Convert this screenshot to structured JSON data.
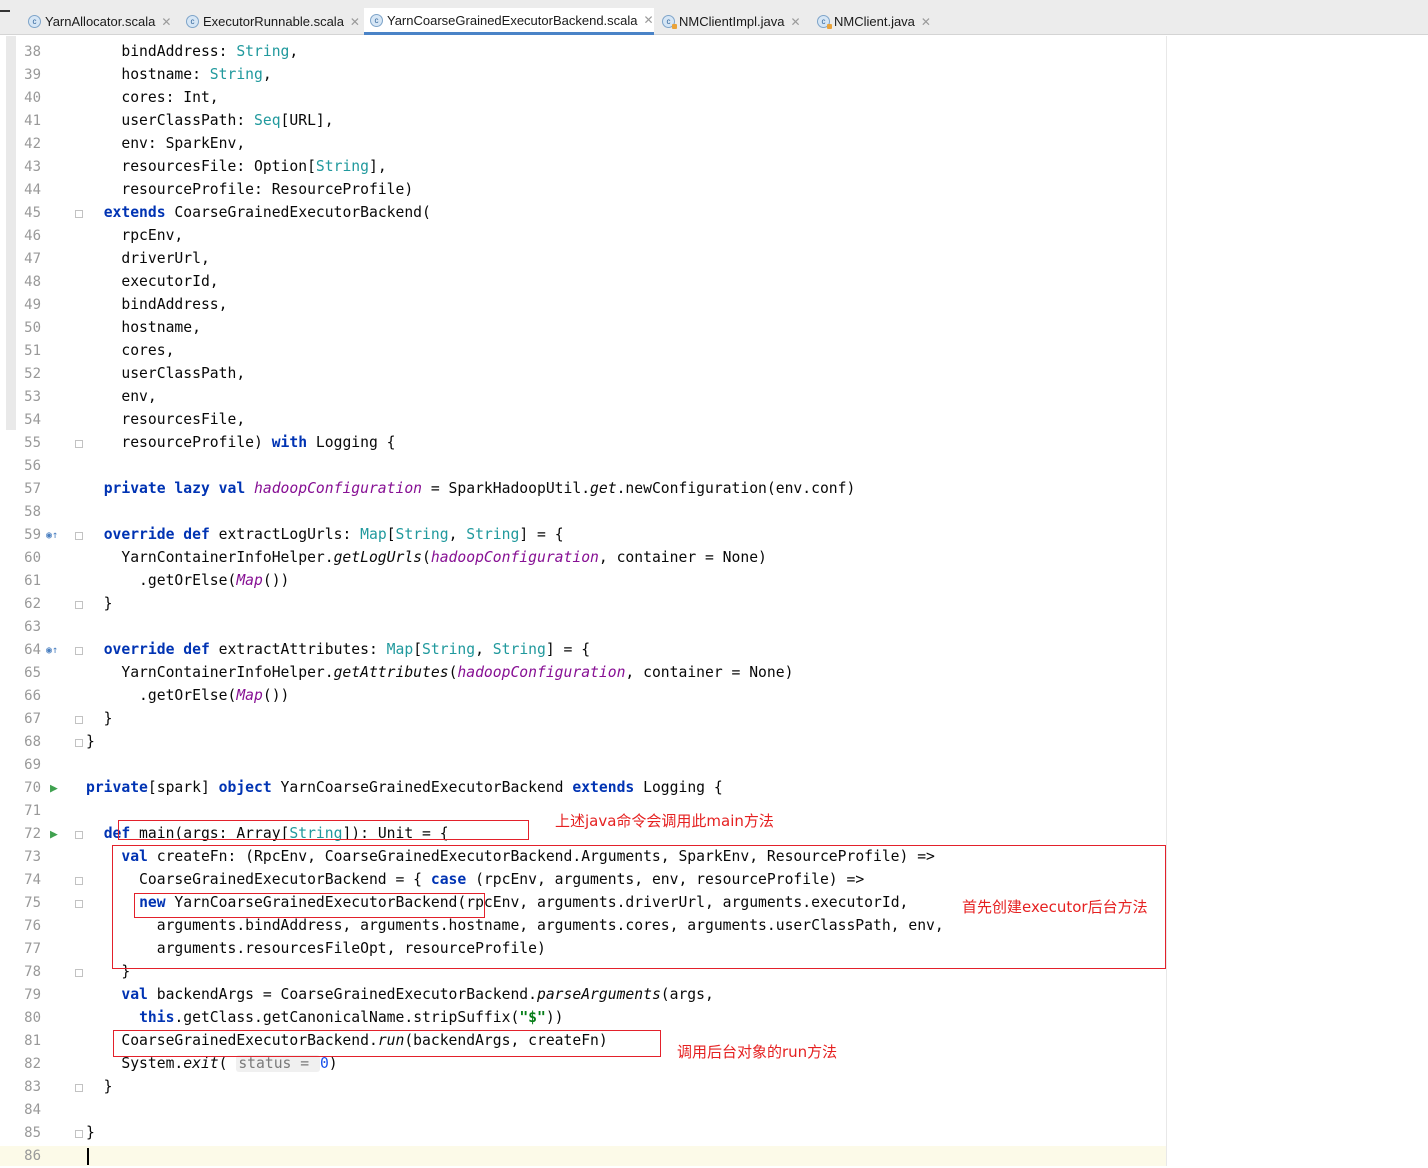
{
  "tabs": [
    {
      "label": "YarnAllocator.scala",
      "kind": "scala",
      "active": false
    },
    {
      "label": "ExecutorRunnable.scala",
      "kind": "scala",
      "active": false
    },
    {
      "label": "YarnCoarseGrainedExecutorBackend.scala",
      "kind": "scala",
      "active": true
    },
    {
      "label": "NMClientImpl.java",
      "kind": "java",
      "active": false
    },
    {
      "label": "NMClient.java",
      "kind": "java",
      "active": false
    }
  ],
  "line_numbers": [
    "38",
    "39",
    "40",
    "41",
    "42",
    "43",
    "44",
    "45",
    "46",
    "47",
    "48",
    "49",
    "50",
    "51",
    "52",
    "53",
    "54",
    "55",
    "56",
    "57",
    "58",
    "59",
    "60",
    "61",
    "62",
    "63",
    "64",
    "65",
    "66",
    "67",
    "68",
    "69",
    "70",
    "71",
    "72",
    "73",
    "74",
    "75",
    "76",
    "77",
    "78",
    "79",
    "80",
    "81",
    "82",
    "83",
    "84",
    "85",
    "86"
  ],
  "code_lines": [
    [
      {
        "t": "    bindAddress: "
      },
      {
        "t": "String",
        "c": "ty"
      },
      {
        "t": ","
      }
    ],
    [
      {
        "t": "    hostname: "
      },
      {
        "t": "String",
        "c": "ty"
      },
      {
        "t": ","
      }
    ],
    [
      {
        "t": "    cores: Int,"
      }
    ],
    [
      {
        "t": "    userClassPath: "
      },
      {
        "t": "Seq",
        "c": "ty"
      },
      {
        "t": "[URL],"
      }
    ],
    [
      {
        "t": "    env: SparkEnv,"
      }
    ],
    [
      {
        "t": "    resourcesFile: Option["
      },
      {
        "t": "String",
        "c": "ty"
      },
      {
        "t": "],"
      }
    ],
    [
      {
        "t": "    resourceProfile: ResourceProfile)"
      }
    ],
    [
      {
        "t": "  "
      },
      {
        "t": "extends",
        "c": "kw"
      },
      {
        "t": " CoarseGrainedExecutorBackend("
      }
    ],
    [
      {
        "t": "    rpcEnv,"
      }
    ],
    [
      {
        "t": "    driverUrl,"
      }
    ],
    [
      {
        "t": "    executorId,"
      }
    ],
    [
      {
        "t": "    bindAddress,"
      }
    ],
    [
      {
        "t": "    hostname,"
      }
    ],
    [
      {
        "t": "    cores,"
      }
    ],
    [
      {
        "t": "    userClassPath,"
      }
    ],
    [
      {
        "t": "    env,"
      }
    ],
    [
      {
        "t": "    resourcesFile,"
      }
    ],
    [
      {
        "t": "    resourceProfile) "
      },
      {
        "t": "with",
        "c": "kw"
      },
      {
        "t": " Logging {"
      }
    ],
    [],
    [
      {
        "t": "  "
      },
      {
        "t": "private lazy val",
        "c": "kw"
      },
      {
        "t": " "
      },
      {
        "t": "hadoopConfiguration",
        "c": "it"
      },
      {
        "t": " = SparkHadoopUtil."
      },
      {
        "t": "get",
        "c": "fn"
      },
      {
        "t": ".newConfiguration(env.conf)"
      }
    ],
    [],
    [
      {
        "t": "  "
      },
      {
        "t": "override def",
        "c": "kw"
      },
      {
        "t": " extractLogUrls: "
      },
      {
        "t": "Map",
        "c": "ty"
      },
      {
        "t": "["
      },
      {
        "t": "String",
        "c": "ty"
      },
      {
        "t": ", "
      },
      {
        "t": "String",
        "c": "ty"
      },
      {
        "t": "] = {"
      }
    ],
    [
      {
        "t": "    YarnContainerInfoHelper."
      },
      {
        "t": "getLogUrls",
        "c": "fn"
      },
      {
        "t": "("
      },
      {
        "t": "hadoopConfiguration",
        "c": "it"
      },
      {
        "t": ", container = None)"
      }
    ],
    [
      {
        "t": "      .getOrElse("
      },
      {
        "t": "Map",
        "c": "it"
      },
      {
        "t": "())"
      }
    ],
    [
      {
        "t": "  }"
      }
    ],
    [],
    [
      {
        "t": "  "
      },
      {
        "t": "override def",
        "c": "kw"
      },
      {
        "t": " extractAttributes: "
      },
      {
        "t": "Map",
        "c": "ty"
      },
      {
        "t": "["
      },
      {
        "t": "String",
        "c": "ty"
      },
      {
        "t": ", "
      },
      {
        "t": "String",
        "c": "ty"
      },
      {
        "t": "] = {"
      }
    ],
    [
      {
        "t": "    YarnContainerInfoHelper."
      },
      {
        "t": "getAttributes",
        "c": "fn"
      },
      {
        "t": "("
      },
      {
        "t": "hadoopConfiguration",
        "c": "it"
      },
      {
        "t": ", container = None)"
      }
    ],
    [
      {
        "t": "      .getOrElse("
      },
      {
        "t": "Map",
        "c": "it"
      },
      {
        "t": "())"
      }
    ],
    [
      {
        "t": "  }"
      }
    ],
    [
      {
        "t": "}"
      }
    ],
    [],
    [
      {
        "t": "private",
        "c": "kw"
      },
      {
        "t": "[spark] "
      },
      {
        "t": "object",
        "c": "kw"
      },
      {
        "t": " YarnCoarseGrainedExecutorBackend "
      },
      {
        "t": "extends",
        "c": "kw"
      },
      {
        "t": " Logging {"
      }
    ],
    [],
    [
      {
        "t": "  "
      },
      {
        "t": "def",
        "c": "kw"
      },
      {
        "t": " main(args: Array["
      },
      {
        "t": "String",
        "c": "ty"
      },
      {
        "t": "]): Unit = {"
      }
    ],
    [
      {
        "t": "    "
      },
      {
        "t": "val",
        "c": "kw"
      },
      {
        "t": " createFn: (RpcEnv, CoarseGrainedExecutorBackend.Arguments, SparkEnv, ResourceProfile) =>"
      }
    ],
    [
      {
        "t": "      CoarseGrainedExecutorBackend = { "
      },
      {
        "t": "case",
        "c": "kw"
      },
      {
        "t": " (rpcEnv, arguments, env, resourceProfile) =>"
      }
    ],
    [
      {
        "t": "      "
      },
      {
        "t": "new",
        "c": "kw"
      },
      {
        "t": " YarnCoarseGrainedExecutorBackend(rpcEnv, arguments.driverUrl, arguments.executorId,"
      }
    ],
    [
      {
        "t": "        arguments.bindAddress, arguments.hostname, arguments.cores, arguments.userClassPath, env,"
      }
    ],
    [
      {
        "t": "        arguments.resourcesFileOpt, resourceProfile)"
      }
    ],
    [
      {
        "t": "    }"
      }
    ],
    [
      {
        "t": "    "
      },
      {
        "t": "val",
        "c": "kw"
      },
      {
        "t": " backendArgs = CoarseGrainedExecutorBackend."
      },
      {
        "t": "parseArguments",
        "c": "fn"
      },
      {
        "t": "(args,"
      }
    ],
    [
      {
        "t": "      "
      },
      {
        "t": "this",
        "c": "kw"
      },
      {
        "t": ".getClass.getCanonicalName.stripSuffix("
      },
      {
        "t": "\"$\"",
        "c": "str"
      },
      {
        "t": "))"
      }
    ],
    [
      {
        "t": "    CoarseGrainedExecutorBackend."
      },
      {
        "t": "run",
        "c": "fn"
      },
      {
        "t": "(backendArgs, createFn)"
      }
    ],
    [
      {
        "t": "    System."
      },
      {
        "t": "exit",
        "c": "fn"
      },
      {
        "t": "( "
      },
      {
        "t": "status = ",
        "c": "hint"
      },
      {
        "t": "0",
        "c": "num"
      },
      {
        "t": ")"
      }
    ],
    [
      {
        "t": "  }"
      }
    ],
    [],
    [
      {
        "t": "}"
      }
    ],
    []
  ],
  "annotations": {
    "main_note": "上述java命令会调用此main方法",
    "backend_note": "首先创建executor后台方法",
    "run_note": "调用后台对象的run方法"
  }
}
